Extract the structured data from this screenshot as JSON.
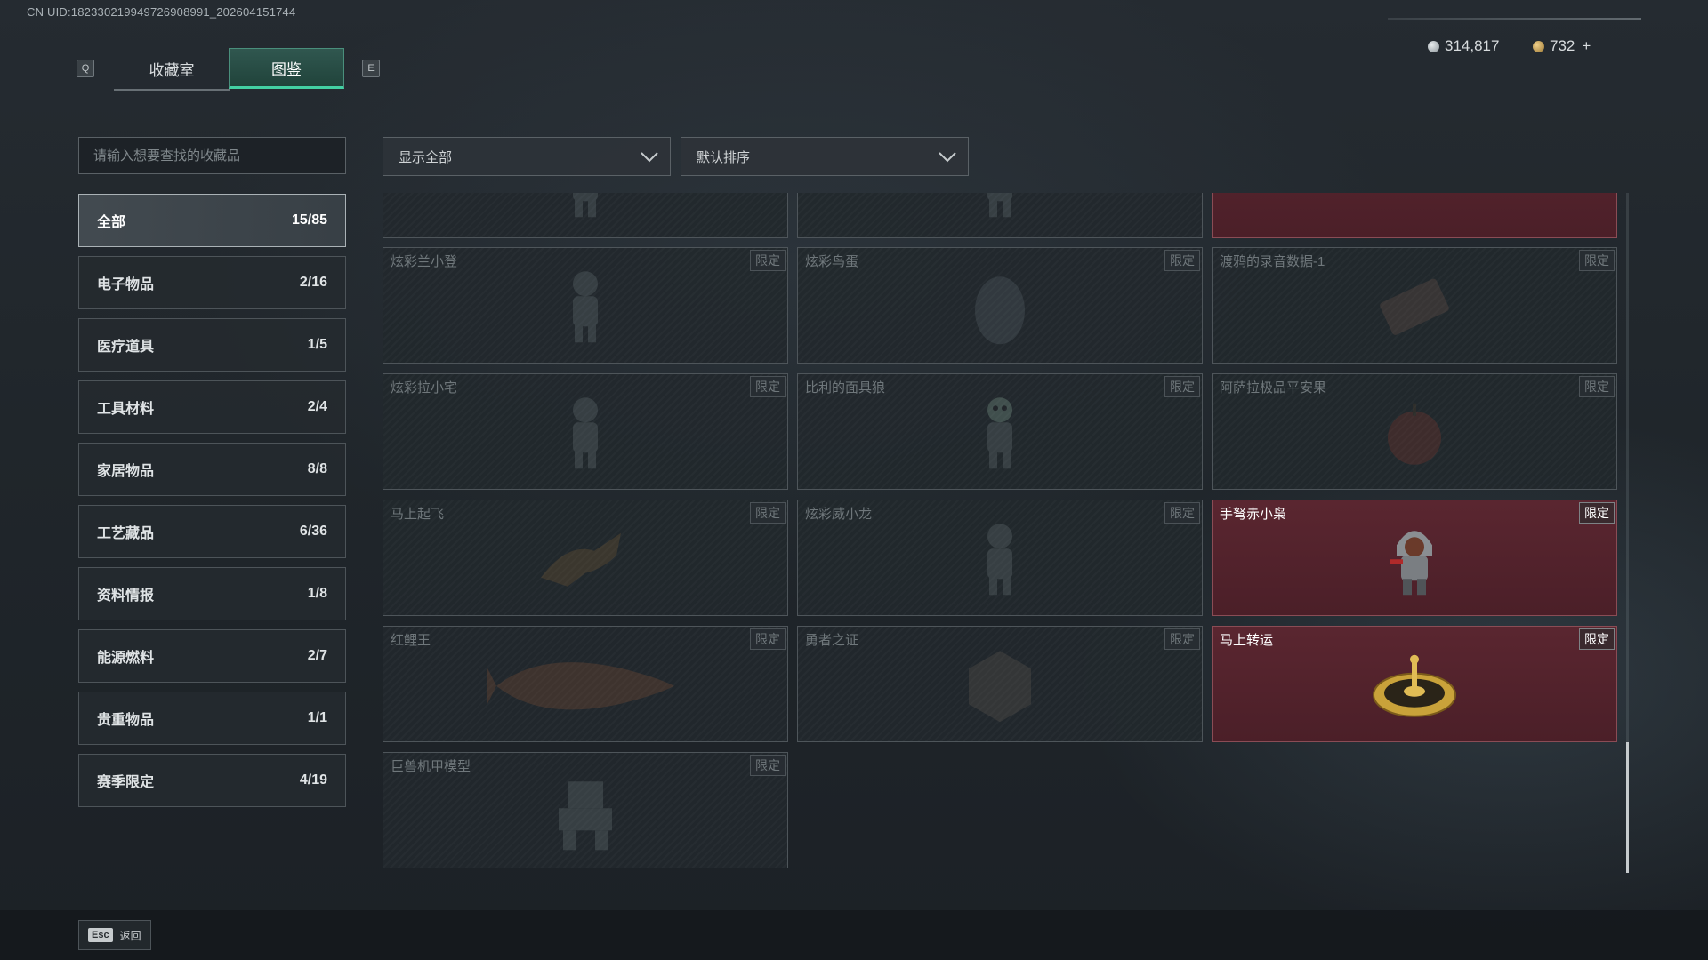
{
  "uid_text": "CN UID:182330219949726908991_202604151744",
  "tabs": {
    "prev_key": "Q",
    "next_key": "E",
    "items": [
      "收藏室",
      "图鉴"
    ],
    "active": 1
  },
  "currency": {
    "silver": "314,817",
    "gold": "732",
    "add_symbol": "+"
  },
  "search": {
    "placeholder": "请输入想要查找的收藏品"
  },
  "filters": {
    "show": "显示全部",
    "sort": "默认排序"
  },
  "categories": [
    {
      "name": "全部",
      "count": "15/85",
      "active": true
    },
    {
      "name": "电子物品",
      "count": "2/16"
    },
    {
      "name": "医疗道具",
      "count": "1/5"
    },
    {
      "name": "工具材料",
      "count": "2/4"
    },
    {
      "name": "家居物品",
      "count": "8/8"
    },
    {
      "name": "工艺藏品",
      "count": "6/36"
    },
    {
      "name": "资料情报",
      "count": "1/8"
    },
    {
      "name": "能源燃料",
      "count": "2/7"
    },
    {
      "name": "贵重物品",
      "count": "1/1"
    },
    {
      "name": "赛季限定",
      "count": "4/19"
    }
  ],
  "badge_label": "限定",
  "items": [
    {
      "name": "",
      "owned": false,
      "icon": "figure-icon"
    },
    {
      "name": "",
      "owned": false,
      "icon": "figure-icon"
    },
    {
      "name": "",
      "owned": true,
      "icon": "shell-icon"
    },
    {
      "name": "炫彩兰小登",
      "owned": false,
      "icon": "figure-icon"
    },
    {
      "name": "炫彩鸟蛋",
      "owned": false,
      "icon": "egg-icon"
    },
    {
      "name": "渡鸦的录音数据-1",
      "owned": false,
      "icon": "drive-icon"
    },
    {
      "name": "炫彩拉小宅",
      "owned": false,
      "icon": "figure-icon"
    },
    {
      "name": "比利的面具狼",
      "owned": false,
      "icon": "mask-figure-icon"
    },
    {
      "name": "阿萨拉极品平安果",
      "owned": false,
      "icon": "apple-icon"
    },
    {
      "name": "马上起飞",
      "owned": false,
      "icon": "horse-icon"
    },
    {
      "name": "炫彩威小龙",
      "owned": false,
      "icon": "figure-icon"
    },
    {
      "name": "手弩赤小枭",
      "owned": true,
      "icon": "hooded-figure-icon"
    },
    {
      "name": "红鲤王",
      "owned": false,
      "icon": "fish-icon"
    },
    {
      "name": "勇者之证",
      "owned": false,
      "icon": "medal-icon"
    },
    {
      "name": "马上转运",
      "owned": true,
      "icon": "gold-wheel-icon"
    },
    {
      "name": "巨兽机甲模型",
      "owned": false,
      "icon": "mech-icon"
    }
  ],
  "footer": {
    "esc_key": "Esc",
    "back_label": "返回"
  }
}
